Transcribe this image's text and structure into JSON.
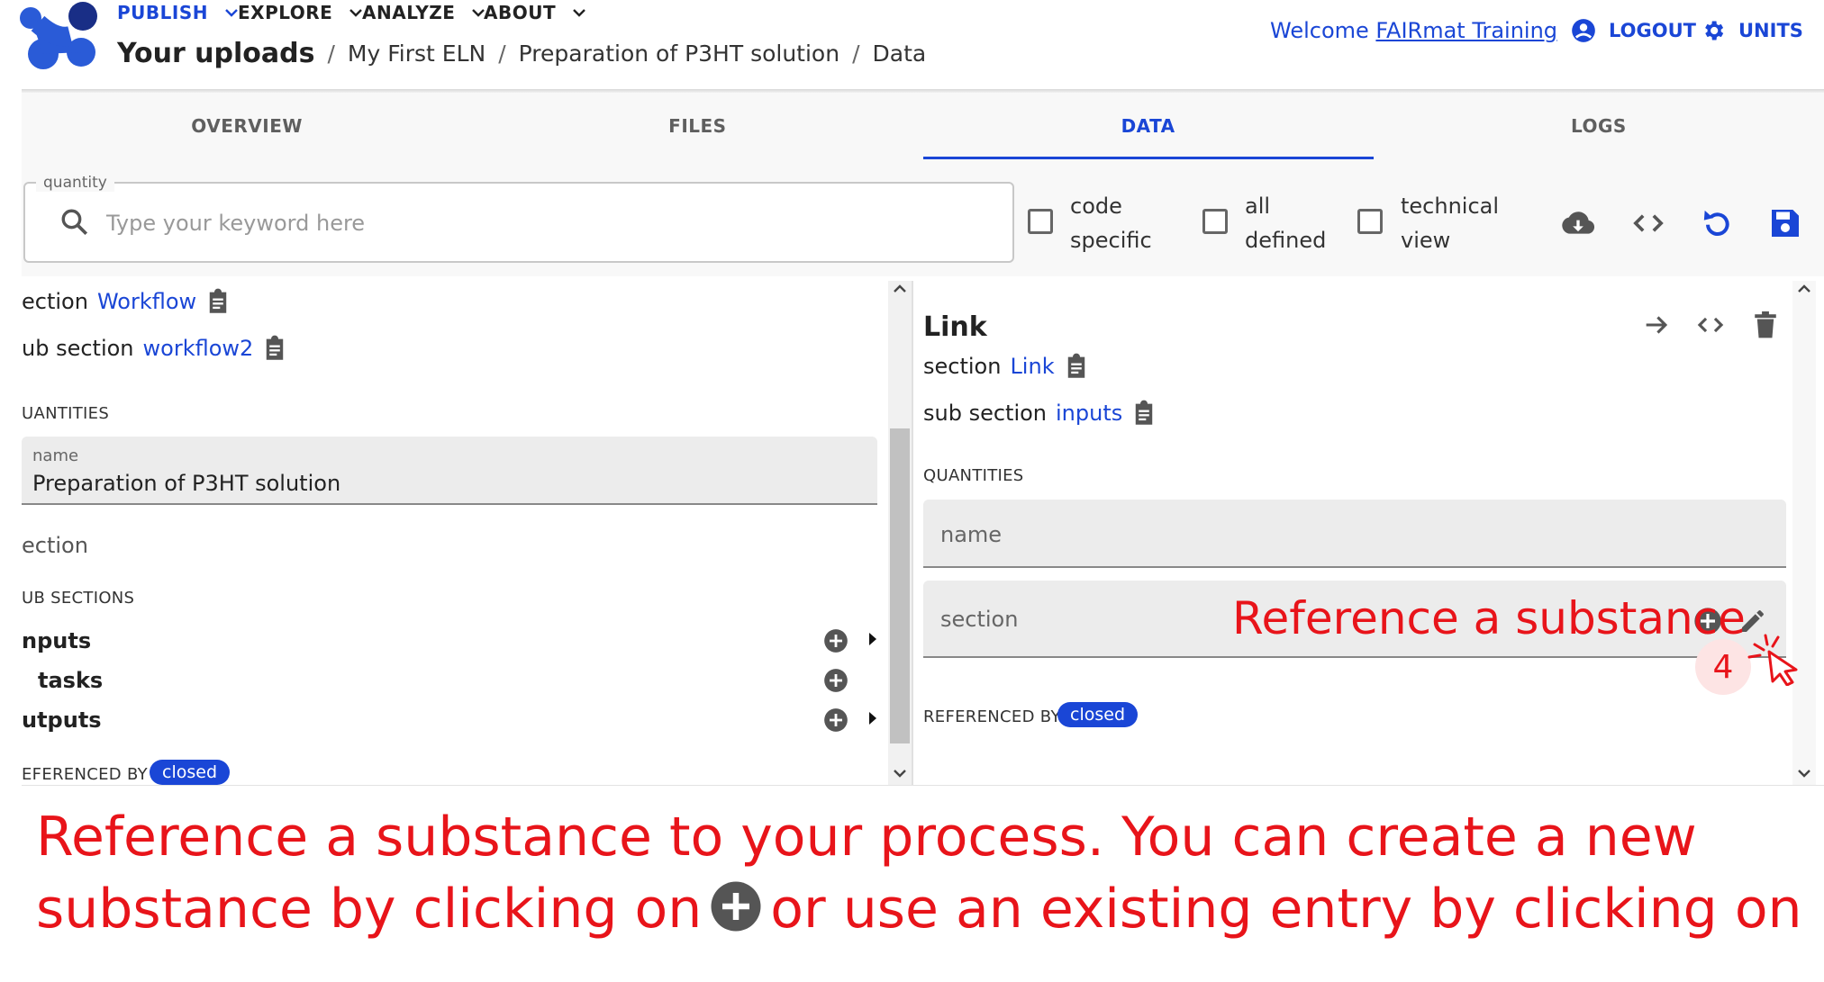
{
  "header": {
    "nav": [
      {
        "label": "PUBLISH",
        "color": "#1a46d6"
      },
      {
        "label": "EXPLORE",
        "color": "#222222"
      },
      {
        "label": "ANALYZE",
        "color": "#222222"
      },
      {
        "label": "ABOUT",
        "color": "#222222"
      }
    ],
    "breadcrumb": [
      "Your uploads",
      "My First ELN",
      "Preparation of P3HT solution",
      "Data"
    ],
    "welcome_prefix": "Welcome ",
    "welcome_user": "FAIRmat Training",
    "logout_label": "LOGOUT",
    "units_label": "UNITS"
  },
  "tabs": [
    {
      "label": "OVERVIEW",
      "active": false
    },
    {
      "label": "FILES",
      "active": false
    },
    {
      "label": "DATA",
      "active": true
    },
    {
      "label": "LOGS",
      "active": false
    }
  ],
  "toolbar": {
    "search_legend": "quantity",
    "search_placeholder": "Type your keyword here",
    "search_value": "",
    "checkboxes": [
      {
        "line1": "code",
        "line2": "specific",
        "checked": false
      },
      {
        "line1": "all",
        "line2": "defined",
        "checked": false
      },
      {
        "line1": "technical",
        "line2": "view",
        "checked": false
      }
    ],
    "icons": [
      "cloud-download-icon",
      "code-icon",
      "reload-icon",
      "save-icon"
    ]
  },
  "left_panel": {
    "section_label": "ection",
    "section_link": "Workflow",
    "subsection_label": "ub section",
    "subsection_link": "workflow2",
    "quantities_heading": "UANTITIES",
    "name_field_label": "name",
    "name_field_value": "Preparation of P3HT solution",
    "section_heading": "ection",
    "subsections_heading": "UB SECTIONS",
    "subsections": [
      {
        "label": "nputs",
        "has_add": true,
        "has_expand": true
      },
      {
        "label": "tasks",
        "has_add": true,
        "has_expand": false
      },
      {
        "label": "utputs",
        "has_add": true,
        "has_expand": true
      }
    ],
    "referenced_by_label": "EFERENCED BY",
    "referenced_by_badge": "closed"
  },
  "right_panel": {
    "title": "Link",
    "section_label": "section",
    "section_link": "Link",
    "subsection_label": "sub section",
    "subsection_link": "inputs",
    "quantities_heading": "QUANTITIES",
    "name_field_label": "name",
    "section_field_label": "section",
    "referenced_by_label": "REFERENCED BY",
    "referenced_by_badge": "closed"
  },
  "annotation": {
    "callout": "Reference a substance",
    "step_number": "4",
    "caption_line1": "Reference a substance to your process. You can create a new",
    "caption_line2_part1": "substance by clicking on",
    "caption_line2_part2": "or use an existing entry by clicking on",
    "color": "#e8141a"
  },
  "colors": {
    "accent": "#1a46d6",
    "annotation": "#e8141a",
    "field_bg": "#ececec"
  }
}
